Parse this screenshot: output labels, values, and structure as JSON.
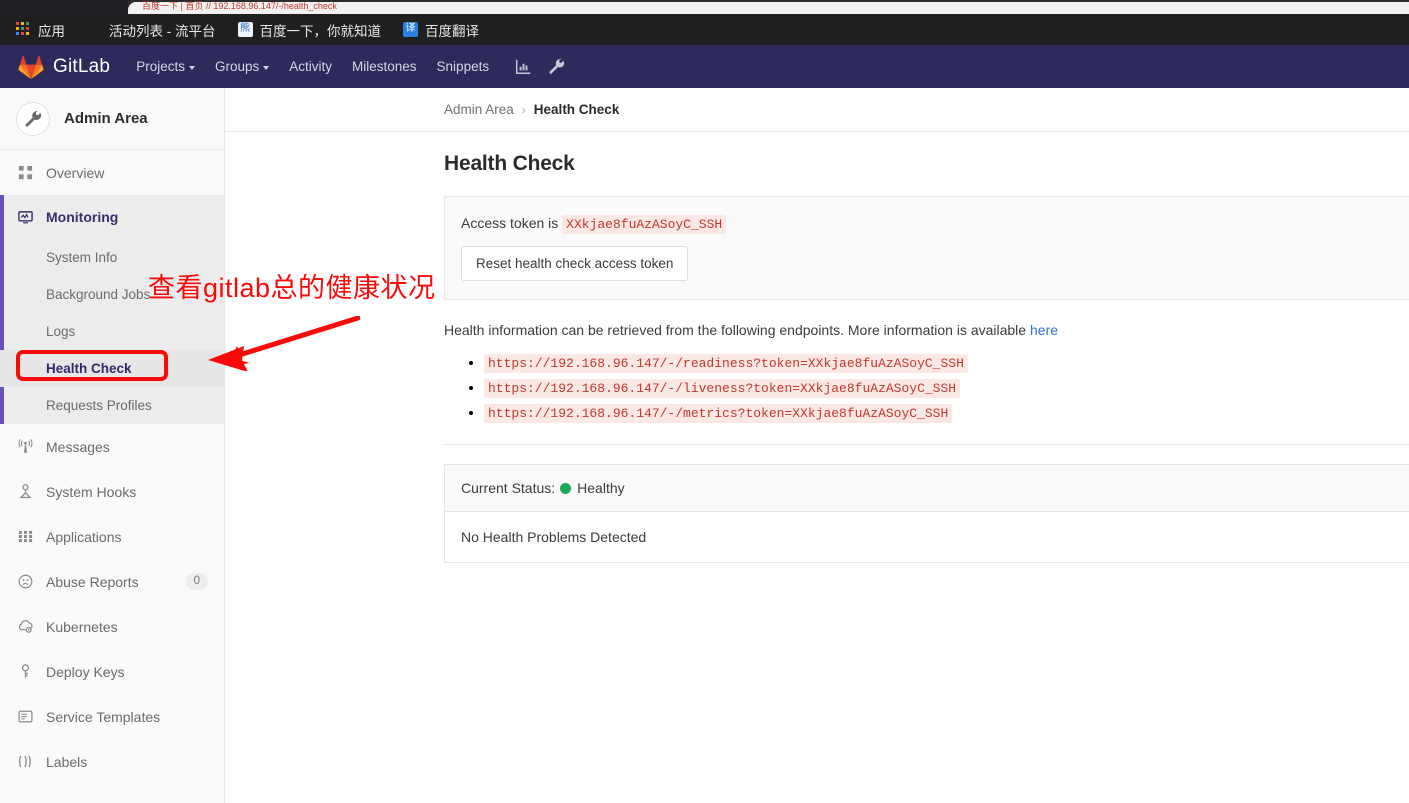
{
  "browser": {
    "tab_ghost": "百度一下 | 首页 // 192.168.96.147/-/health_check",
    "bookmarks": [
      {
        "label": "应用",
        "icon": "apps-grid-icon"
      },
      {
        "label": "活动列表 - 流平台",
        "icon": "globe-icon"
      },
      {
        "label": "百度一下，你就知道",
        "icon": "baidu-icon"
      },
      {
        "label": "百度翻译",
        "icon": "translate-icon"
      }
    ]
  },
  "navbar": {
    "brand": "GitLab",
    "links": [
      {
        "label": "Projects",
        "has_caret": true
      },
      {
        "label": "Groups",
        "has_caret": true
      },
      {
        "label": "Activity",
        "has_caret": false
      },
      {
        "label": "Milestones",
        "has_caret": false
      },
      {
        "label": "Snippets",
        "has_caret": false
      }
    ],
    "icons": [
      "chart-icon",
      "wrench-icon"
    ],
    "bg_color": "#2e2a5b"
  },
  "sidebar": {
    "title": "Admin Area",
    "avatar_icon": "wrench-icon",
    "overview": {
      "label": "Overview",
      "icon": "grid-icon"
    },
    "monitoring": {
      "label": "Monitoring",
      "icon": "monitor-icon",
      "accent_color": "#6b4fbb",
      "children": [
        {
          "label": "System Info",
          "active": false
        },
        {
          "label": "Background Jobs",
          "active": false
        },
        {
          "label": "Logs",
          "active": false
        },
        {
          "label": "Health Check",
          "active": true
        },
        {
          "label": "Requests Profiles",
          "active": false
        }
      ]
    },
    "items": [
      {
        "label": "Messages",
        "icon": "broadcast-icon",
        "badge": ""
      },
      {
        "label": "System Hooks",
        "icon": "hook-icon",
        "badge": ""
      },
      {
        "label": "Applications",
        "icon": "apps-icon",
        "badge": ""
      },
      {
        "label": "Abuse Reports",
        "icon": "sad-face-icon",
        "badge": "0"
      },
      {
        "label": "Kubernetes",
        "icon": "kubernetes-icon",
        "badge": ""
      },
      {
        "label": "Deploy Keys",
        "icon": "key-icon",
        "badge": ""
      },
      {
        "label": "Service Templates",
        "icon": "template-icon",
        "badge": ""
      },
      {
        "label": "Labels",
        "icon": "labels-icon",
        "badge": ""
      }
    ]
  },
  "breadcrumb": {
    "root": "Admin Area",
    "separator": "›",
    "current": "Health Check"
  },
  "main": {
    "page_title": "Health Check",
    "token_label": "Access token is",
    "access_token": "XXkjae8fuAzASoyC_SSH",
    "reset_button": "Reset health check access token",
    "info_text_before": "Health information can be retrieved from the following endpoints. More information is available ",
    "info_link": "here",
    "info_text_after": "",
    "endpoints": [
      "https://192.168.96.147/-/readiness?token=XXkjae8fuAzASoyC_SSH",
      "https://192.168.96.147/-/liveness?token=XXkjae8fuAzASoyC_SSH",
      "https://192.168.96.147/-/metrics?token=XXkjae8fuAzASoyC_SSH"
    ],
    "status_label": "Current Status:",
    "status_value": "Healthy",
    "status_color": "#1aaa55",
    "problems_text": "No Health Problems Detected"
  },
  "annotation": {
    "text": "查看gitlab总的健康状况",
    "color": "#fb0a0a"
  }
}
